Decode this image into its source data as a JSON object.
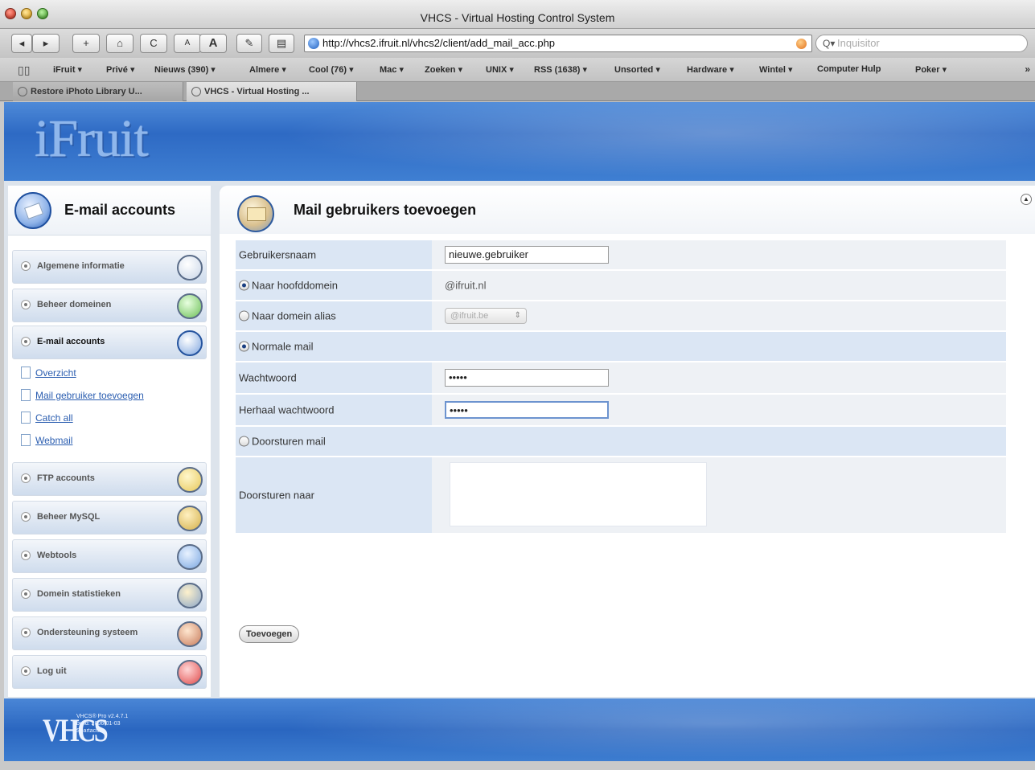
{
  "window": {
    "title": "VHCS - Virtual Hosting Control System"
  },
  "toolbar": {
    "back": "◂",
    "forward": "▸",
    "add": "+",
    "home": "⌂",
    "reload": "C",
    "text_small": "A",
    "text_large": "A",
    "edit": "✎",
    "print": "▤",
    "url": "http://vhcs2.ifruit.nl/vhcs2/client/add_mail_acc.php",
    "search_placeholder": "Inquisitor"
  },
  "bookmarks": [
    "iFruit ▾",
    "Privé ▾",
    "Nieuws (390) ▾",
    "Almere ▾",
    "Cool (76) ▾",
    "Mac ▾",
    "Zoeken ▾",
    "UNIX ▾",
    "RSS (1638) ▾",
    "Unsorted ▾",
    "Hardware ▾",
    "Wintel ▾",
    "Computer Hulp",
    "Poker ▾"
  ],
  "bookmarks_more": "»",
  "tabs": [
    "Restore iPhoto Library U...",
    "VHCS - Virtual Hosting ..."
  ],
  "header": {
    "logo": "iFruit"
  },
  "sidebar": {
    "title": "E-mail accounts",
    "items": [
      {
        "label": "Algemene informatie"
      },
      {
        "label": "Beheer domeinen"
      },
      {
        "label": "E-mail accounts"
      },
      {
        "label": "FTP accounts"
      },
      {
        "label": "Beheer MySQL"
      },
      {
        "label": "Webtools"
      },
      {
        "label": "Domein statistieken"
      },
      {
        "label": "Ondersteuning systeem"
      },
      {
        "label": "Log uit"
      }
    ],
    "submenu": [
      "Overzicht",
      "Mail gebruiker toevoegen",
      "Catch all",
      "Webmail"
    ]
  },
  "main": {
    "title": "Mail gebruikers toevoegen",
    "form": {
      "username_label": "Gebruikersnaam",
      "username_value": "nieuwe.gebruiker",
      "main_domain_label": "Naar hoofddomein",
      "main_domain_value": "@ifruit.nl",
      "alias_label": "Naar domein alias",
      "alias_select_value": "@ifruit.be",
      "normal_mail_label": "Normale mail",
      "password_label": "Wachtwoord",
      "password_value": "•••••",
      "repeat_password_label": "Herhaal wachtwoord",
      "repeat_password_value": "•••••",
      "forward_mail_label": "Doorsturen mail",
      "forward_to_label": "Doorsturen naar",
      "submit_label": "Toevoegen"
    }
  },
  "footer": {
    "logo": "VHCS",
    "info": "VHCS® Pro v2.4.7.1\nbuild: 2006-01-03\nSpartacus"
  }
}
